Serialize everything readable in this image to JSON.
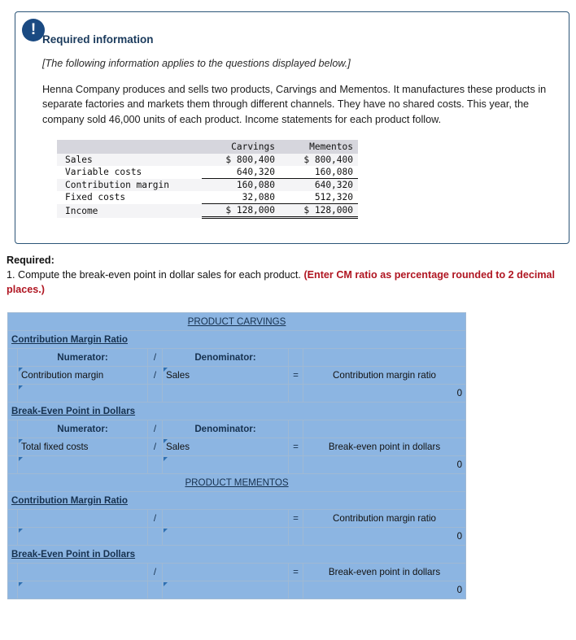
{
  "info_panel": {
    "badge_icon": "exclamation-icon",
    "heading": "Required information",
    "note": "[The following information applies to the questions displayed below.]",
    "paragraph": "Henna Company produces and sells two products, Carvings and Mementos. It manufactures these products in separate factories and markets them through different channels. They have no shared costs. This year, the company sold 46,000 units of each product. Income statements for each product follow."
  },
  "income_statement": {
    "columns": [
      "",
      "Carvings",
      "Mementos"
    ],
    "rows": [
      {
        "label": "Sales",
        "carvings": "$ 800,400",
        "mementos": "$ 800,400"
      },
      {
        "label": "Variable costs",
        "carvings": "640,320",
        "mementos": "160,080"
      },
      {
        "label": "Contribution margin",
        "carvings": "160,080",
        "mementos": "640,320"
      },
      {
        "label": "Fixed costs",
        "carvings": "32,080",
        "mementos": "512,320"
      },
      {
        "label": "Income",
        "carvings": "$ 128,000",
        "mementos": "$ 128,000"
      }
    ]
  },
  "required": {
    "title": "Required:",
    "line": "1. Compute the break-even point in dollar sales for each product.",
    "red_note": "(Enter CM ratio as percentage rounded to 2 decimal places.)"
  },
  "worksheet": {
    "operators": {
      "divide": "/",
      "equals": "="
    },
    "headers": {
      "numerator": "Numerator:",
      "denominator": "Denominator:"
    },
    "sections": [
      {
        "title": "PRODUCT CARVINGS",
        "blocks": [
          {
            "subtitle": "Contribution Margin Ratio",
            "show_headers": true,
            "numerator": "Contribution margin",
            "denominator": "Sales",
            "result_label": "Contribution margin ratio",
            "numerator_value": "",
            "denominator_value": "",
            "result_value": "0",
            "result_highlight": false
          },
          {
            "subtitle": "Break-Even Point in Dollars",
            "show_headers": true,
            "numerator": "Total fixed costs",
            "denominator": "Sales",
            "result_label": "Break-even point in dollars",
            "numerator_value": "",
            "denominator_value": "",
            "result_value": "0",
            "result_highlight": true
          }
        ]
      },
      {
        "title": "PRODUCT MEMENTOS",
        "blocks": [
          {
            "subtitle": "Contribution Margin Ratio",
            "show_headers": false,
            "numerator": "",
            "denominator": "",
            "result_label": "Contribution margin ratio",
            "numerator_value": "",
            "denominator_value": "",
            "result_value": "0",
            "result_highlight": false
          },
          {
            "subtitle": "Break-Even Point in Dollars",
            "show_headers": false,
            "numerator": "",
            "denominator": "",
            "result_label": "Break-even point in dollars",
            "numerator_value": "",
            "denominator_value": "",
            "result_value": "0",
            "result_highlight": true
          }
        ]
      }
    ]
  },
  "colors": {
    "panel_border": "#2c5578",
    "badge": "#1a4a82",
    "worksheet_blue": "#8cb5e2",
    "result_yellow": "#fdfbb0",
    "red_note": "#b01622"
  }
}
